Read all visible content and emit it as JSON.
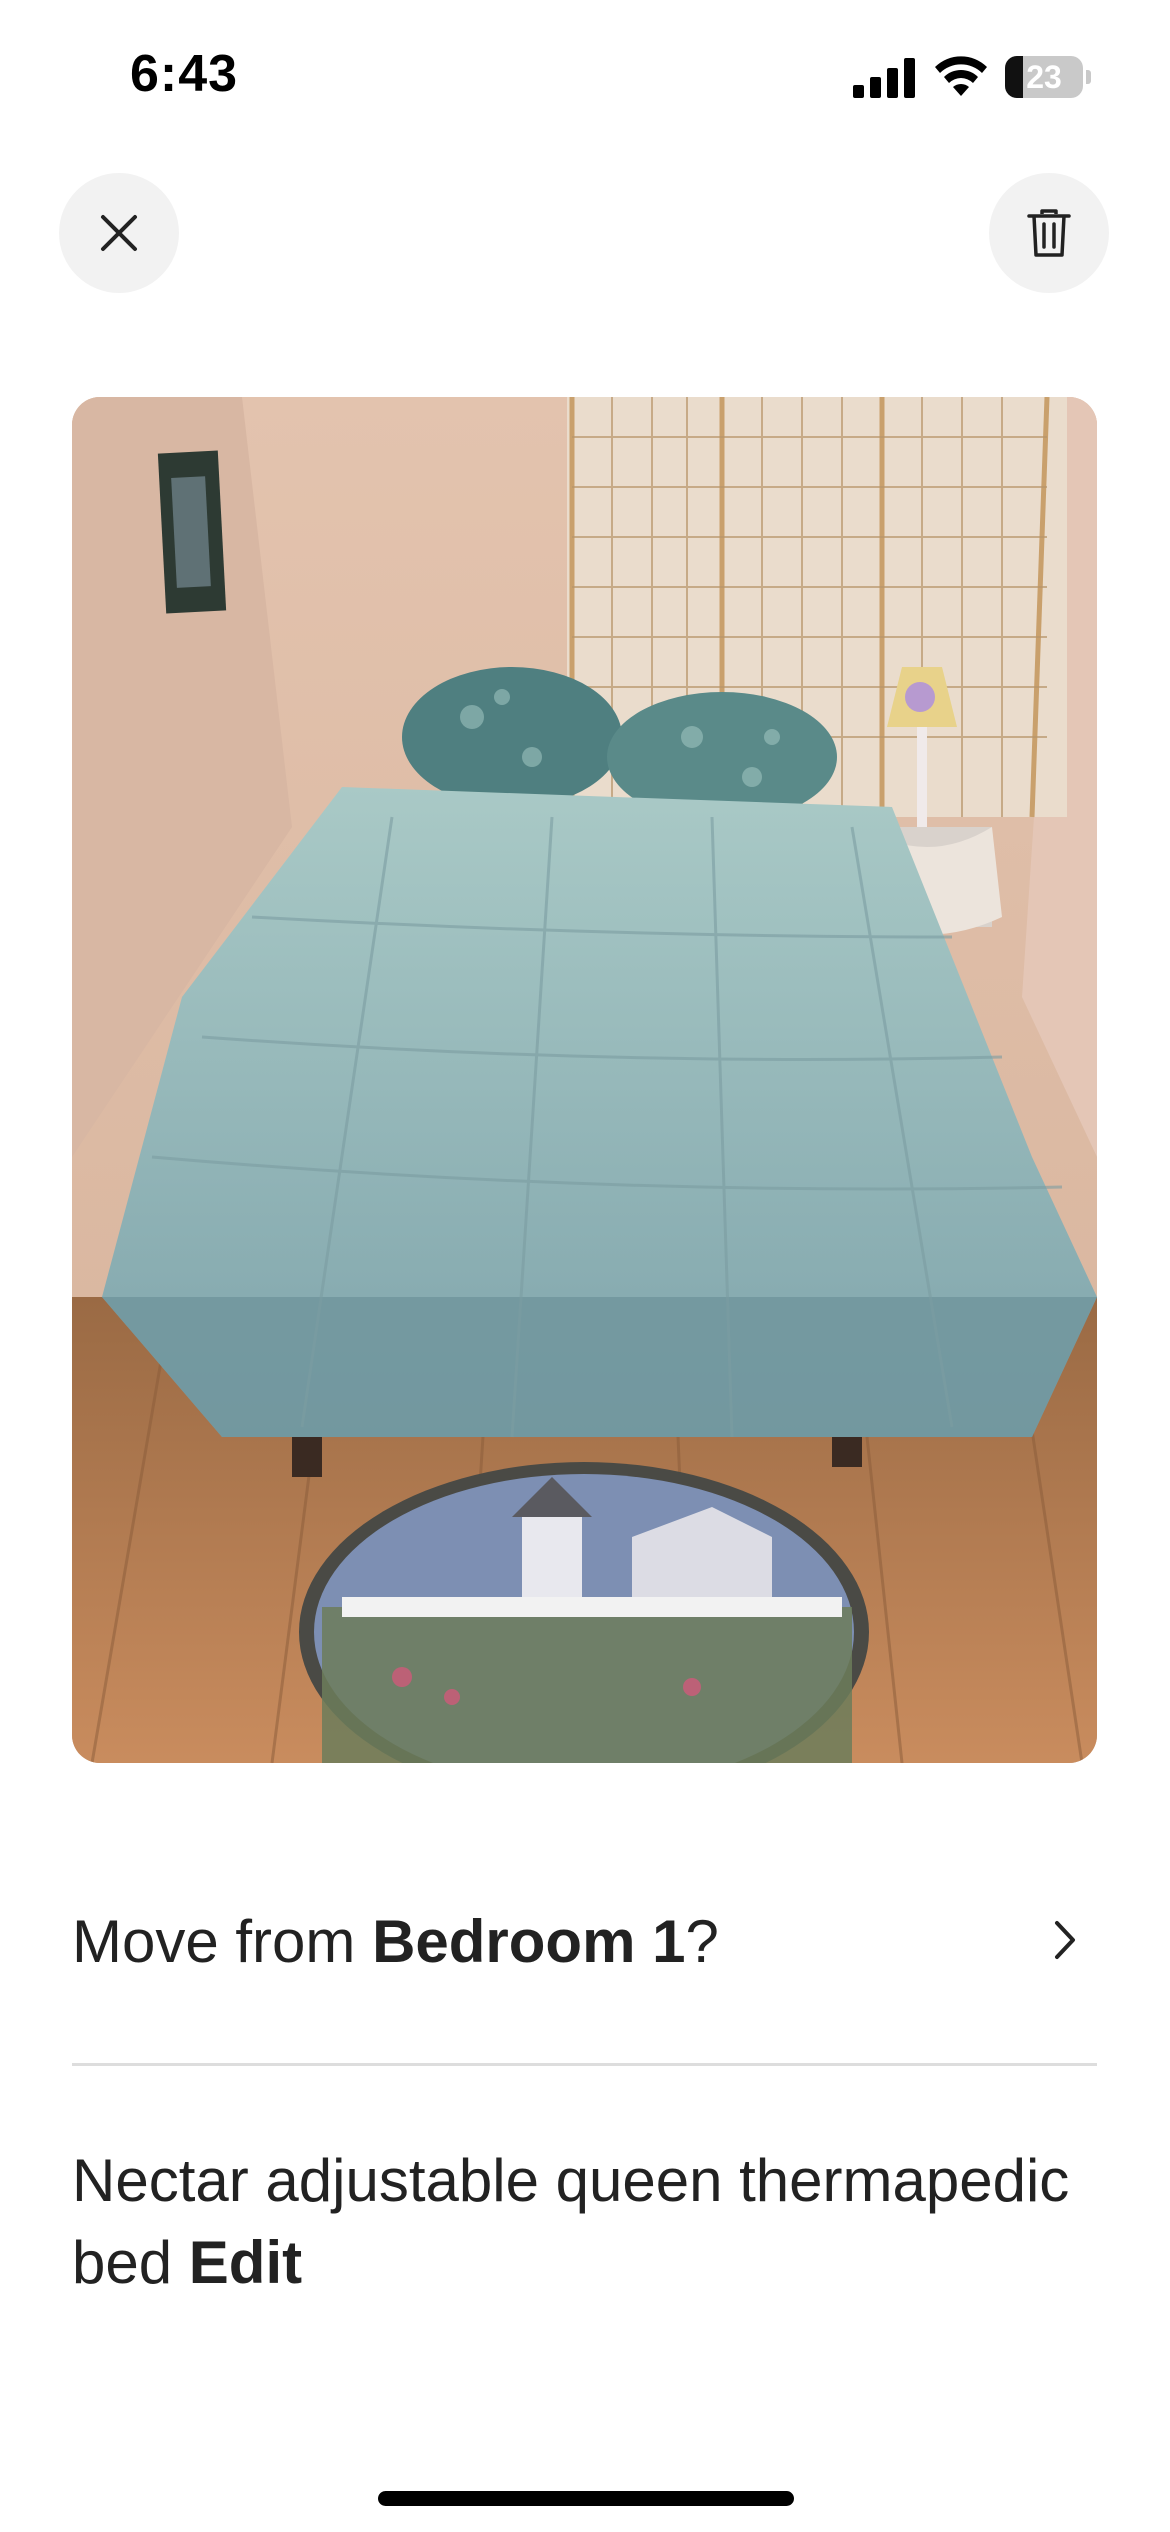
{
  "status_bar": {
    "time": "6:43",
    "battery_level": "23",
    "battery_fraction": 0.23
  },
  "top_actions": {
    "close_icon": "close-icon",
    "delete_icon": "trash-icon"
  },
  "photo": {
    "subject": "bed-photo"
  },
  "move": {
    "prefix": "Move from ",
    "room": "Bedroom 1",
    "suffix": "?",
    "chevron_icon": "chevron-right-icon"
  },
  "description": {
    "text": "Nectar adjustable queen thermapedic bed ",
    "edit_label": "Edit"
  },
  "colors": {
    "text": "#222222",
    "button_bg": "#f2f2f2",
    "divider": "#dddddd"
  }
}
